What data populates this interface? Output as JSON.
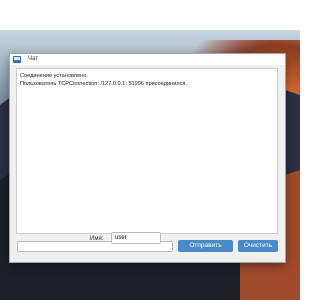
{
  "window": {
    "title": "Чат"
  },
  "log": {
    "lines": [
      "Соединение установлено.",
      "Пользователь TCPConnection: /127.0.0.1: 51996 присоединился."
    ]
  },
  "message": {
    "value": ""
  },
  "buttons": {
    "send_label": "Отправить",
    "clear_label": "Очистить"
  },
  "name": {
    "label": "Имя:",
    "value": "user"
  },
  "colors": {
    "button": "#4a8ac7",
    "titlebar": "#ffffff"
  }
}
